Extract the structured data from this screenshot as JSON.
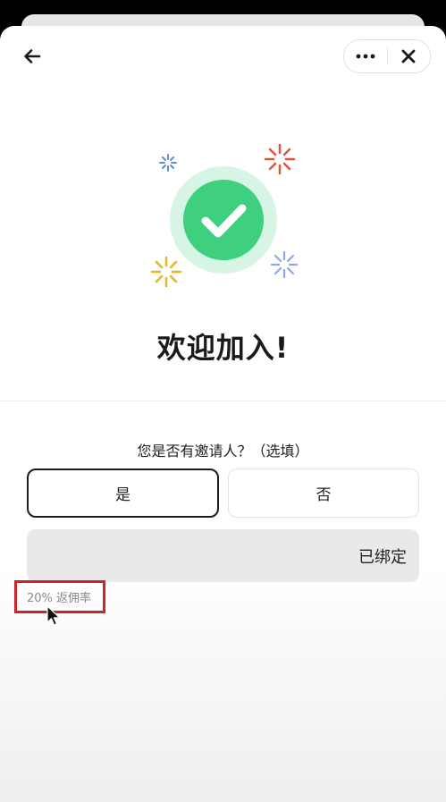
{
  "header": {
    "back_icon": "arrow-left-icon",
    "more_icon": "more-horizontal-icon",
    "close_icon": "close-icon"
  },
  "hero": {
    "icon": "check-circle-icon",
    "accent": "#3ecf7f",
    "halo": "#d6f5e4",
    "sparkle_colors": [
      "#5b8fd6",
      "#e2543a",
      "#e2b81a",
      "#8fa6e6"
    ],
    "title": "欢迎加入!"
  },
  "form": {
    "question": "您是否有邀请人？（选填）",
    "yes_label": "是",
    "no_label": "否",
    "selected": "是",
    "bind_status": "已绑定",
    "rate_text": "20% 返佣率"
  }
}
